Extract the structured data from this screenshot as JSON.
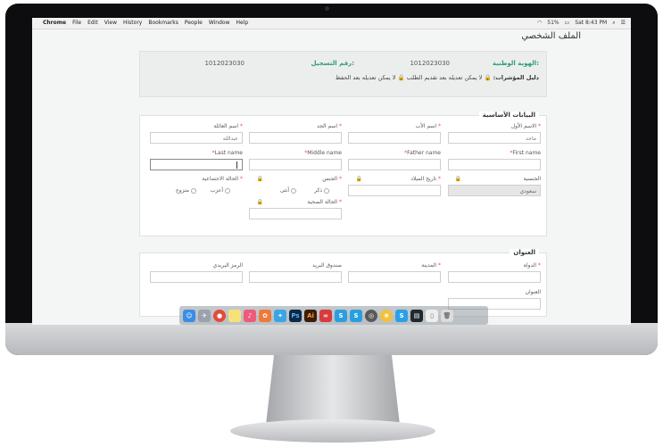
{
  "menubar": {
    "app": "Chrome",
    "items": [
      "File",
      "Edit",
      "View",
      "History",
      "Bookmarks",
      "People",
      "Window",
      "Help"
    ],
    "battery": "51%",
    "clock": "Sat 8:43 PM"
  },
  "page": {
    "title": "الملف الشخصي"
  },
  "info": {
    "national_id_label": "الهوية الوطنية:",
    "national_id_value": "1012023030",
    "reg_no_label": "رقم التسجيل:",
    "reg_no_value": "1012023030",
    "legend_label": "دليل المؤشرات:",
    "legend_cannot_after_submit": "لا يمكن تعديله بعد تقديم الطلب",
    "legend_cannot_after_save": "لا يمكن تعديله بعد الحفظ"
  },
  "basic": {
    "title": "البيانات الأساسية",
    "first_name_ar_label": "الاسم الأول",
    "first_name_ar_value": "ماجد",
    "father_name_ar_label": "اسم الأب",
    "grandfather_name_ar_label": "اسم الجد",
    "family_name_ar_label": "اسم العائلة",
    "family_name_ar_value": "عبدالله",
    "first_name_en_label": "First name",
    "father_name_en_label": "Father name",
    "middle_name_en_label": "Middle name",
    "last_name_en_label": "Last name",
    "nationality_label": "الجنسية",
    "nationality_value": "سعودي",
    "birth_date_label": "تاريخ الميلاد",
    "gender_label": "الجنس",
    "gender_male": "ذكر",
    "gender_female": "أنثى",
    "marital_label": "الحالة الاجتماعية",
    "marital_single": "أعزب",
    "marital_married": "متزوج",
    "health_label": "الحالة الصحية"
  },
  "address": {
    "title": "العنوان",
    "country_label": "الدولة",
    "city_label": "المدينة",
    "po_box_label": "صندوق البريد",
    "postal_code_label": "الرمز البريدي",
    "address_label": "العنوان"
  },
  "dock": [
    "Finder",
    "Launchpad",
    "Chrome",
    "Notes",
    "Music",
    "Photos",
    "Twitter",
    "Photoshop",
    "Illustrator",
    "Creative Cloud",
    "Skype",
    "Skype",
    "Dashboard",
    "Photos Browser",
    "Skype Alt",
    "Terminal",
    "Documents",
    "Trash"
  ]
}
